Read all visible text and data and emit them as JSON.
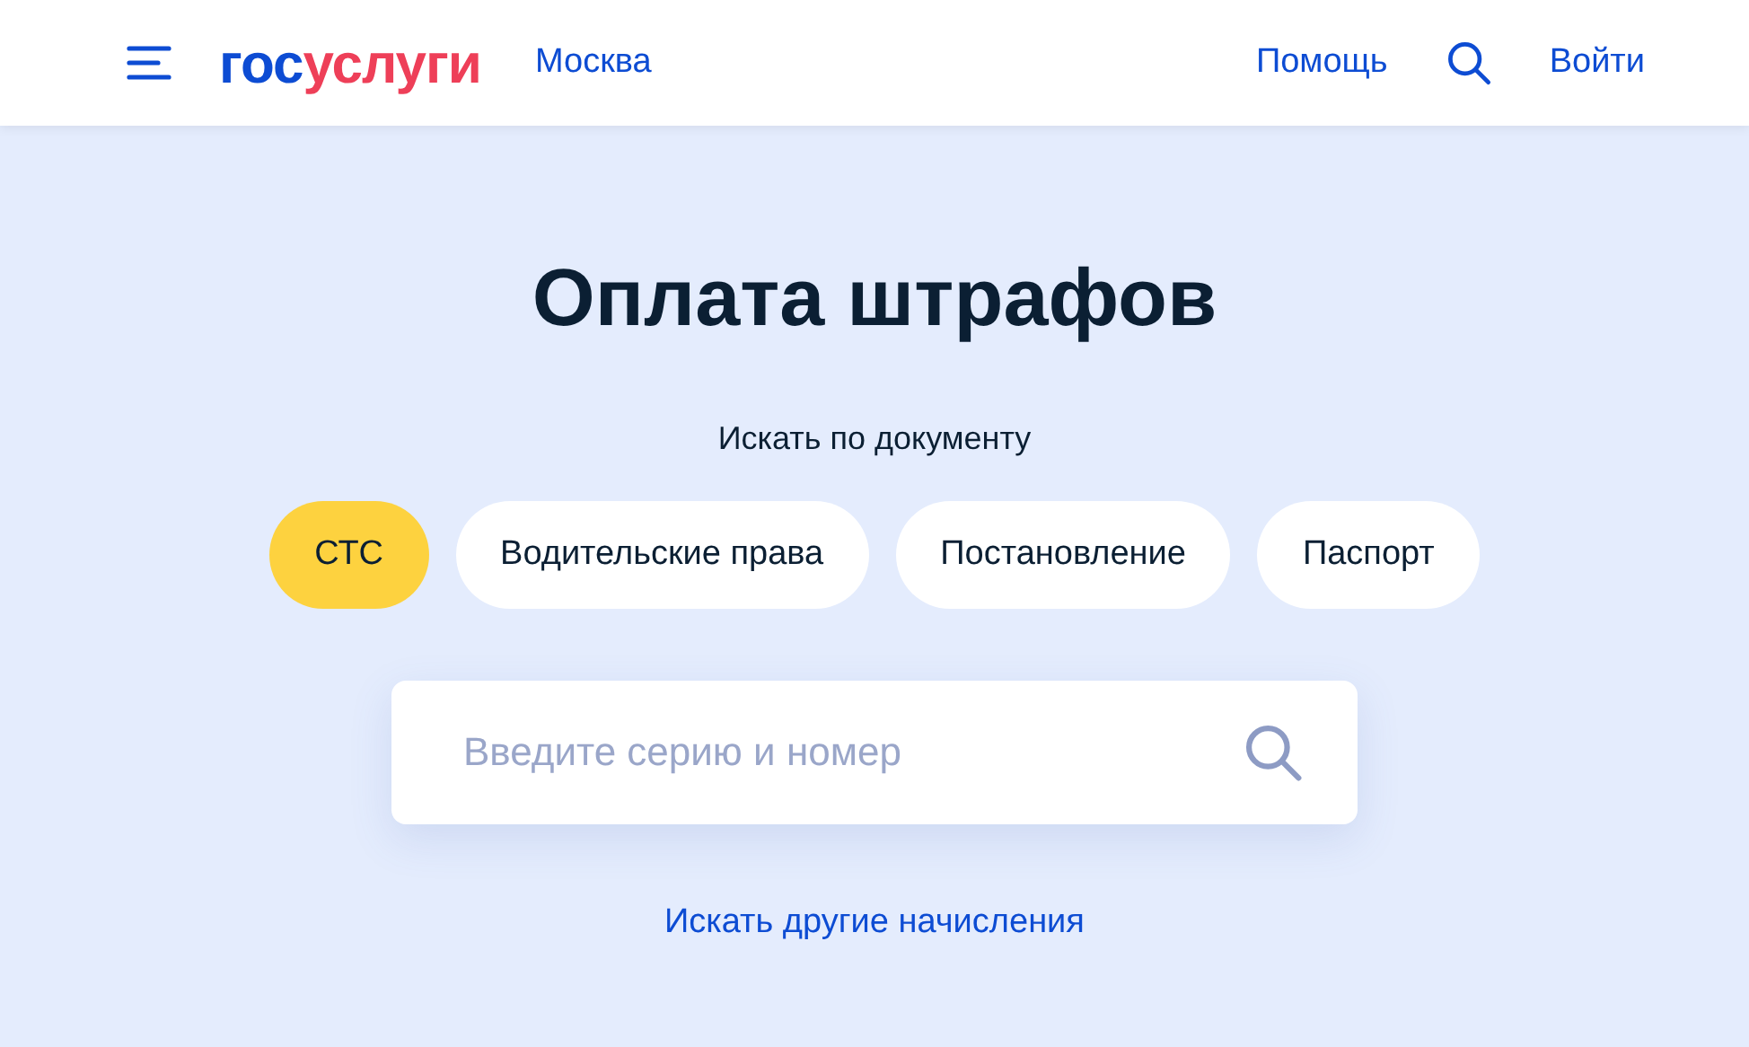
{
  "header": {
    "logo": {
      "prefix": "гос",
      "suffix": "услуги"
    },
    "region": "Москва",
    "help": "Помощь",
    "login": "Войти"
  },
  "title": "Оплата штрафов",
  "search_by": "Искать по документу",
  "documents": [
    {
      "label": "СТС",
      "selected": true
    },
    {
      "label": "Водительские права",
      "selected": false
    },
    {
      "label": "Постановление",
      "selected": false
    },
    {
      "label": "Паспорт",
      "selected": false
    }
  ],
  "search": {
    "placeholder": "Введите серию и номер"
  },
  "other_link": "Искать другие начисления"
}
